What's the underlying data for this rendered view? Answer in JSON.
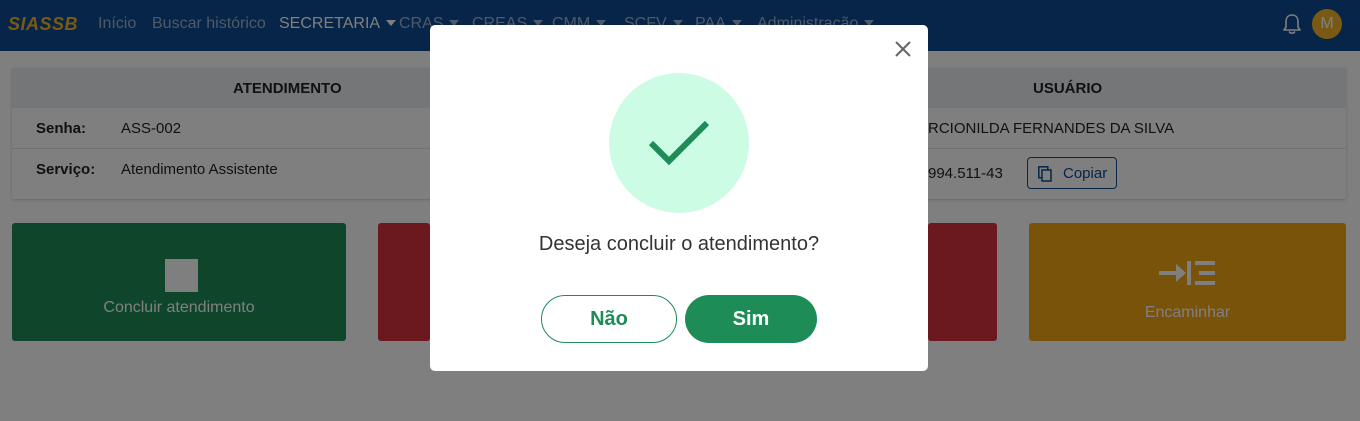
{
  "navbar": {
    "brand": "SIASSB",
    "links": [
      {
        "label": "Início"
      },
      {
        "label": "Buscar histórico"
      },
      {
        "label": "SECRETARIA"
      },
      {
        "label": "CRAS"
      },
      {
        "label": "CREAS"
      },
      {
        "label": "CMM"
      },
      {
        "label": "SCFV"
      },
      {
        "label": "PAA"
      },
      {
        "label": "Administração"
      }
    ],
    "notification_icon": "bell-icon",
    "avatar_initial": "M",
    "colors": {
      "bar": "#0d4a93",
      "brand": "#f0b429"
    }
  },
  "card": {
    "attendance_header": "ATENDIMENTO",
    "user_header": "USUÁRIO",
    "senha_label": "Senha:",
    "senha_value": "ASS-002",
    "servico_label": "Serviço:",
    "servico_value": "Atendimento Assistente",
    "user_name": "RCIONILDA FERNANDES DA SILVA",
    "user_doc": "994.511-43",
    "copy_label": "Copiar"
  },
  "actions": {
    "conclude_label": "Concluir atendimento",
    "forward_label": "Encaminhar",
    "colors": {
      "green": "#1e8c57",
      "red": "#d9303f",
      "yellow": "#f5a615"
    }
  },
  "modal": {
    "question": "Deseja concluir o atendimento?",
    "no_label": "Não",
    "yes_label": "Sim",
    "icon": "check-icon",
    "colors": {
      "success_bg": "#cdfce5",
      "success": "#1e8c57"
    }
  }
}
